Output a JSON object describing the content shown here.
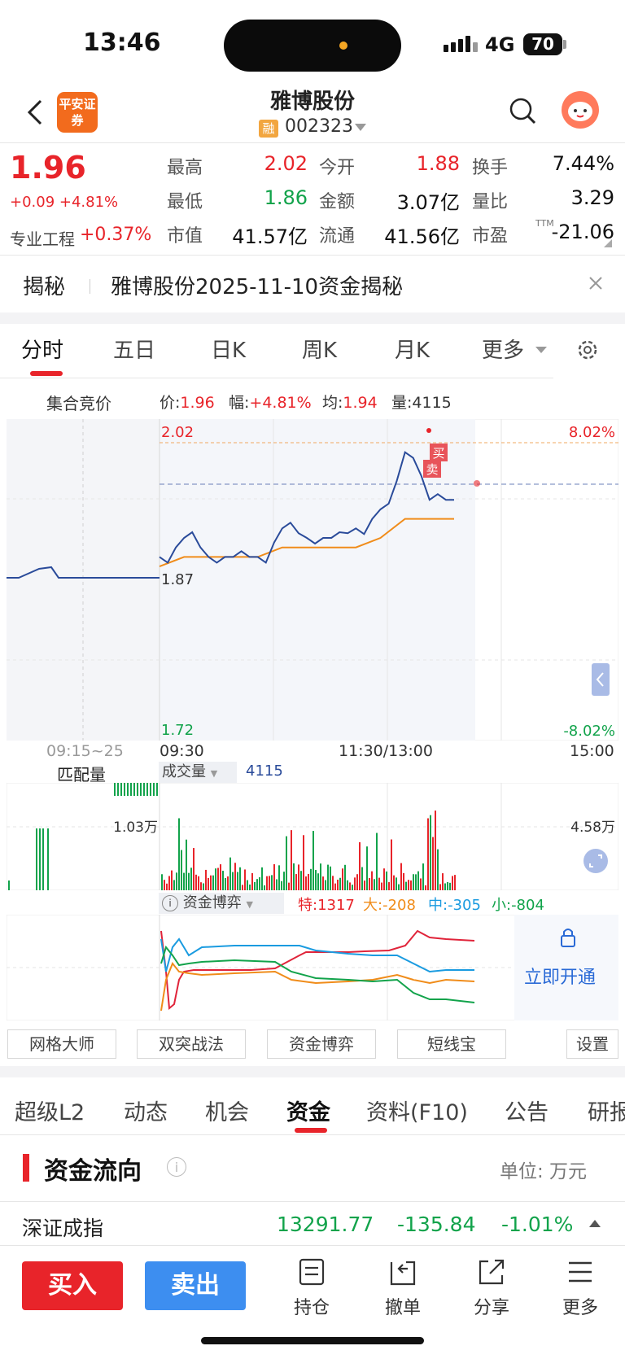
{
  "status": {
    "time": "13:46",
    "network": "4G",
    "battery": "70"
  },
  "header": {
    "broker_logo": "平安证券",
    "stock_name": "雅博股份",
    "margin_badge": "融",
    "stock_code": "002323"
  },
  "quote": {
    "price": "1.96",
    "change": "+0.09 +4.81%",
    "sector_label": "专业工程",
    "sector_change": "+0.37%",
    "fields": [
      {
        "label": "最高",
        "value": "2.02",
        "color": "#e8242a"
      },
      {
        "label": "今开",
        "value": "1.88",
        "color": "#e8242a"
      },
      {
        "label": "换手",
        "value": "7.44%",
        "color": "#111111"
      },
      {
        "label": "最低",
        "value": "1.86",
        "color": "#12a34b"
      },
      {
        "label": "金额",
        "value": "3.07亿",
        "color": "#111111"
      },
      {
        "label": "量比",
        "value": "3.29",
        "color": "#111111"
      },
      {
        "label": "市值",
        "value": "41.57亿",
        "color": "#111111"
      },
      {
        "label": "流通",
        "value": "41.56亿",
        "color": "#111111"
      },
      {
        "label": "市盈",
        "value": "-21.06",
        "color": "#111111"
      }
    ],
    "pe_sup": "TTM"
  },
  "secret": {
    "title": "揭秘",
    "text": "雅博股份2025-11-10资金揭秘"
  },
  "chart_tabs": [
    "分时",
    "五日",
    "日K",
    "周K",
    "月K",
    "更多"
  ],
  "intraday": {
    "auction_label": "集合竞价",
    "price_label": "价:",
    "price_value": "1.96",
    "range_label": "幅:",
    "range_value": "+4.81%",
    "avg_label": "均:",
    "avg_value": "1.94",
    "vol_label": "量:",
    "vol_value": "4115",
    "left_pre_price": "1.87",
    "y_top": "2.02",
    "y_bottom": "1.72",
    "pct_top": "8.02%",
    "pct_bottom": "-8.02%",
    "time_auction": "09:15~25",
    "time_labels": [
      "09:30",
      "11:30/13:00",
      "15:00"
    ],
    "match_vol_label": "匹配量",
    "match_vol_value": "1.03万",
    "vol_selector": "成交量",
    "vol_readout": "4115",
    "vol_max": "4.58万",
    "fund_selector": "资金博弈",
    "fund_te": "特:1317",
    "fund_da": "大:-208",
    "fund_zhong": "中:-305",
    "fund_xiao": "小:-804",
    "open_now": "立即开通",
    "buy_marker": "买",
    "sell_marker": "卖"
  },
  "chart_data": {
    "type": "line",
    "x": [
      "09:30",
      "09:45",
      "10:00",
      "10:15",
      "10:30",
      "10:45",
      "11:00",
      "11:15",
      "11:30",
      "13:00",
      "13:15",
      "13:30",
      "13:45"
    ],
    "series": [
      {
        "values": [
          1.9,
          1.92,
          1.9,
          1.9,
          1.9,
          1.93,
          1.92,
          1.92,
          1.93,
          1.95,
          2.01,
          1.96,
          1.96
        ]
      },
      {
        "values": [
          1.89,
          1.9,
          1.9,
          1.9,
          1.9,
          1.91,
          1.91,
          1.91,
          1.91,
          1.92,
          1.94,
          1.94,
          1.94
        ]
      }
    ],
    "ylim": [
      1.72,
      2.02
    ]
  },
  "tools": [
    "网格大师",
    "双突战法",
    "资金博弈",
    "短线宝",
    "设置"
  ],
  "f_tabs": [
    "超级L2",
    "动态",
    "机会",
    "资金",
    "资料(F10)",
    "公告",
    "研报"
  ],
  "flow": {
    "title": "资金流向",
    "unit": "单位: 万元"
  },
  "index_row": {
    "name": "深证成指",
    "value": "13291.77",
    "change": "-135.84",
    "pct": "-1.01%"
  },
  "bottom_nav": {
    "buy": "买入",
    "sell": "卖出",
    "items": [
      "持仓",
      "撤单",
      "分享",
      "更多"
    ]
  }
}
